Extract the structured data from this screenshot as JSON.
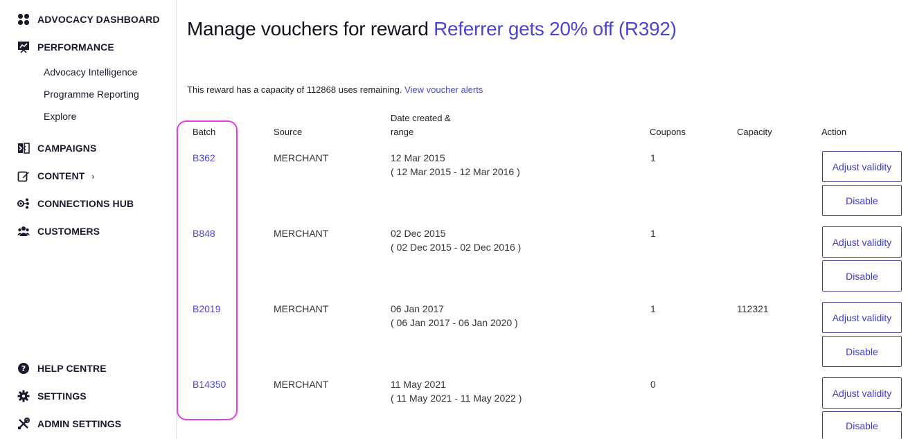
{
  "sidebar": {
    "items": [
      {
        "label": "ADVOCACY DASHBOARD"
      },
      {
        "label": "PERFORMANCE"
      },
      {
        "label": "CAMPAIGNS"
      },
      {
        "label": "CONTENT",
        "chevron": "›"
      },
      {
        "label": "CONNECTIONS HUB"
      },
      {
        "label": "CUSTOMERS"
      }
    ],
    "sub_items": [
      "Advocacy Intelligence",
      "Programme Reporting",
      "Explore"
    ],
    "bottom_items": [
      {
        "label": "HELP CENTRE"
      },
      {
        "label": "SETTINGS"
      },
      {
        "label": "ADMIN SETTINGS"
      }
    ]
  },
  "header": {
    "title_prefix": "Manage vouchers for reward",
    "reward_name": "Referrer gets 20% off (R392)"
  },
  "capacity": {
    "text": "This reward has a capacity of 112868 uses remaining.",
    "link": "View voucher alerts"
  },
  "table": {
    "headers": {
      "batch": "Batch",
      "source": "Source",
      "date_line1": "Date created &",
      "date_line2": "range",
      "coupons": "Coupons",
      "capacity": "Capacity",
      "action": "Action"
    },
    "rows": [
      {
        "batch": "B362",
        "source": "MERCHANT",
        "date": "12 Mar 2015",
        "range": "( 12 Mar 2015 - 12 Mar 2016 )",
        "coupons": "1",
        "capacity": "",
        "adjust": "Adjust validity",
        "disable": "Disable"
      },
      {
        "batch": "B848",
        "source": "MERCHANT",
        "date": "02 Dec 2015",
        "range": "( 02 Dec 2015 - 02 Dec 2016 )",
        "coupons": "1",
        "capacity": "",
        "adjust": "Adjust validity",
        "disable": "Disable"
      },
      {
        "batch": "B2019",
        "source": "MERCHANT",
        "date": "06 Jan 2017",
        "range": "( 06 Jan 2017 - 06 Jan 2020 )",
        "coupons": "1",
        "capacity": "112321",
        "adjust": "Adjust validity",
        "disable": "Disable"
      },
      {
        "batch": "B14350",
        "source": "MERCHANT",
        "date": "11 May 2021",
        "range": "( 11 May 2021 - 11 May 2022 )",
        "coupons": "0",
        "capacity": "",
        "adjust": "Adjust validity",
        "disable": "Disable"
      }
    ]
  },
  "colors": {
    "accent": "#4b45d6",
    "highlight": "#e83ce0"
  }
}
